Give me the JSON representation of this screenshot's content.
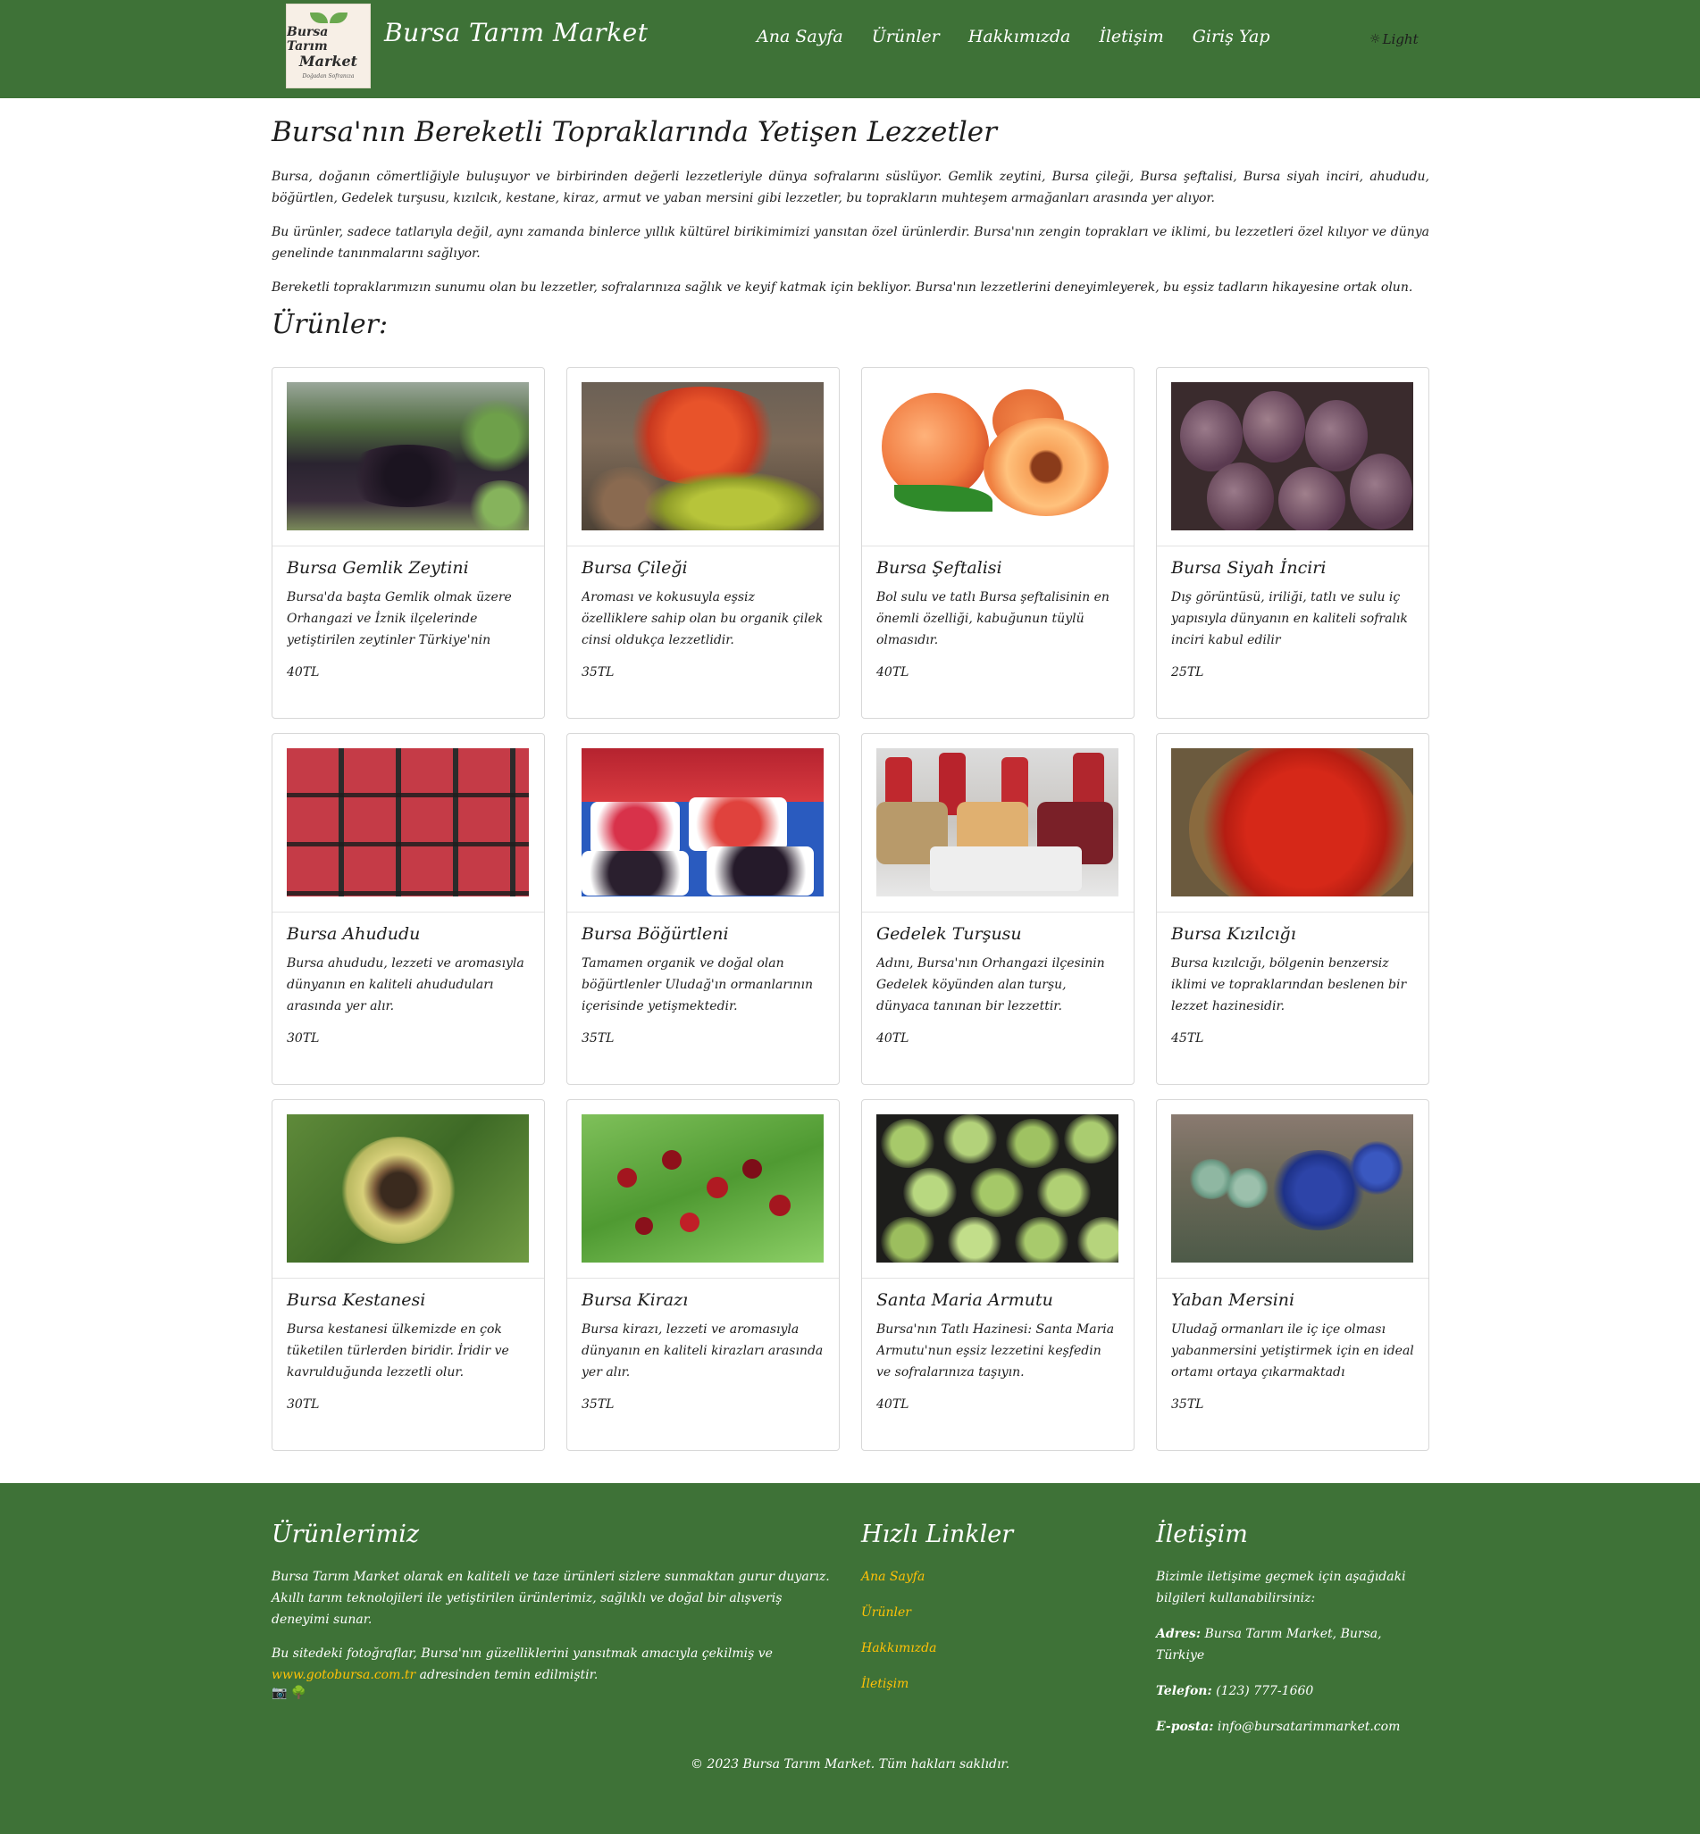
{
  "header": {
    "logo_line1": "Bursa Tarım",
    "logo_line2": "Market",
    "logo_line3": "Doğadan Sofranıza",
    "brand": "Bursa Tarım Market",
    "nav": [
      "Ana Sayfa",
      "Ürünler",
      "Hakkımızda",
      "İletişim",
      "Giriş Yap"
    ],
    "theme_label": "Light",
    "theme_icon": "sun-icon"
  },
  "main": {
    "title": "Bursa'nın Bereketli Topraklarında Yetişen Lezzetler",
    "paragraphs": [
      "Bursa, doğanın cömertliğiyle buluşuyor ve birbirinden değerli lezzetleriyle dünya sofralarını süslüyor. Gemlik zeytini, Bursa çileği, Bursa şeftalisi, Bursa siyah inciri, ahududu, böğürtlen, Gedelek turşusu, kızılcık, kestane, kiraz, armut ve yaban mersini gibi lezzetler, bu toprakların muhteşem armağanları arasında yer alıyor.",
      "Bu ürünler, sadece tatlarıyla değil, aynı zamanda binlerce yıllık kültürel birikimimizi yansıtan özel ürünlerdir. Bursa'nın zengin toprakları ve iklimi, bu lezzetleri özel kılıyor ve dünya genelinde tanınmalarını sağlıyor.",
      "Bereketli topraklarımızın sunumu olan bu lezzetler, sofralarınıza sağlık ve keyif katmak için bekliyor. Bursa'nın lezzetlerini deneyimleyerek, bu eşsiz tadların hikayesine ortak olun."
    ],
    "products_title": "Ürünler:",
    "products": [
      {
        "name": "Bursa Gemlik Zeytini",
        "desc": "Bursa'da başta Gemlik olmak üzere Orhangazi ve İznik ilçelerinde yetiştirilen zeytinler Türkiye'nin",
        "price": "40TL"
      },
      {
        "name": "Bursa Çileği",
        "desc": "Aroması ve kokusuyla eşsiz özelliklere sahip olan bu organik çilek cinsi oldukça lezzetlidir.",
        "price": "35TL"
      },
      {
        "name": "Bursa Şeftalisi",
        "desc": "Bol sulu ve tatlı Bursa şeftalisinin en önemli özelliği, kabuğunun tüylü olmasıdır.",
        "price": "40TL"
      },
      {
        "name": "Bursa Siyah İnciri",
        "desc": "Dış görüntüsü, iriliği, tatlı ve sulu iç yapısıyla dünyanın en kaliteli sofralık inciri kabul edilir",
        "price": "25TL"
      },
      {
        "name": "Bursa Ahududu",
        "desc": "Bursa ahududu, lezzeti ve aromasıyla dünyanın en kaliteli ahududuları arasında yer alır.",
        "price": "30TL"
      },
      {
        "name": "Bursa Böğürtleni",
        "desc": "Tamamen organik ve doğal olan böğürtlenler Uludağ'ın ormanlarının içerisinde yetişmektedir.",
        "price": "35TL"
      },
      {
        "name": "Gedelek Turşusu",
        "desc": "Adını, Bursa'nın Orhangazi ilçesinin Gedelek köyünden alan turşu, dünyaca tanınan bir lezzettir.",
        "price": "40TL"
      },
      {
        "name": "Bursa Kızılcığı",
        "desc": "Bursa kızılcığı, bölgenin benzersiz iklimi ve topraklarından beslenen bir lezzet hazinesidir.",
        "price": "45TL"
      },
      {
        "name": "Bursa Kestanesi",
        "desc": "Bursa kestanesi ülkemizde en çok tüketilen türlerden biridir. İridir ve kavrulduğunda lezzetli olur.",
        "price": "30TL"
      },
      {
        "name": "Bursa Kirazı",
        "desc": "Bursa kirazı, lezzeti ve aromasıyla dünyanın en kaliteli kirazları arasında yer alır.",
        "price": "35TL"
      },
      {
        "name": "Santa Maria Armutu",
        "desc": "Bursa'nın Tatlı Hazinesi: Santa Maria Armutu'nun eşsiz lezzetini keşfedin ve sofralarınıza taşıyın.",
        "price": "40TL"
      },
      {
        "name": "Yaban Mersini",
        "desc": "Uludağ ormanları ile iç içe olması yabanmersini yetiştirmek için en ideal ortamı ortaya çıkarmaktadı",
        "price": "35TL"
      }
    ]
  },
  "footer": {
    "about_title": "Ürünlerimiz",
    "about_text": "Bursa Tarım Market olarak en kaliteli ve taze ürünleri sizlere sunmaktan gurur duyarız. Akıllı tarım teknolojileri ile yetiştirilen ürünlerimiz, sağlıklı ve doğal bir alışveriş deneyimi sunar.",
    "photo_text_before": "Bu sitedeki fotoğraflar, Bursa'nın güzelliklerini yansıtmak amacıyla çekilmiş ve",
    "photo_link": "www.gotobursa.com.tr",
    "photo_text_after": "adresinden temin edilmiştir.",
    "links_title": "Hızlı Linkler",
    "links": [
      "Ana Sayfa",
      "Ürünler",
      "Hakkımızda",
      "İletişim"
    ],
    "contact_title": "İletişim",
    "contact_intro": "Bizimle iletişime geçmek için aşağıdaki bilgileri kullanabilirsiniz:",
    "address_label": "Adres:",
    "address": "Bursa Tarım Market, Bursa, Türkiye",
    "phone_label": "Telefon:",
    "phone": "(123) 777-1660",
    "email_label": "E-posta:",
    "email": "info@bursatarimmarket.com",
    "copyright": "© 2023 Bursa Tarım Market. Tüm hakları saklıdır.",
    "icons": [
      "camera-icon",
      "tree-icon"
    ]
  },
  "colors": {
    "header_bg": "#3e7237",
    "link_accent": "#ffc107"
  }
}
